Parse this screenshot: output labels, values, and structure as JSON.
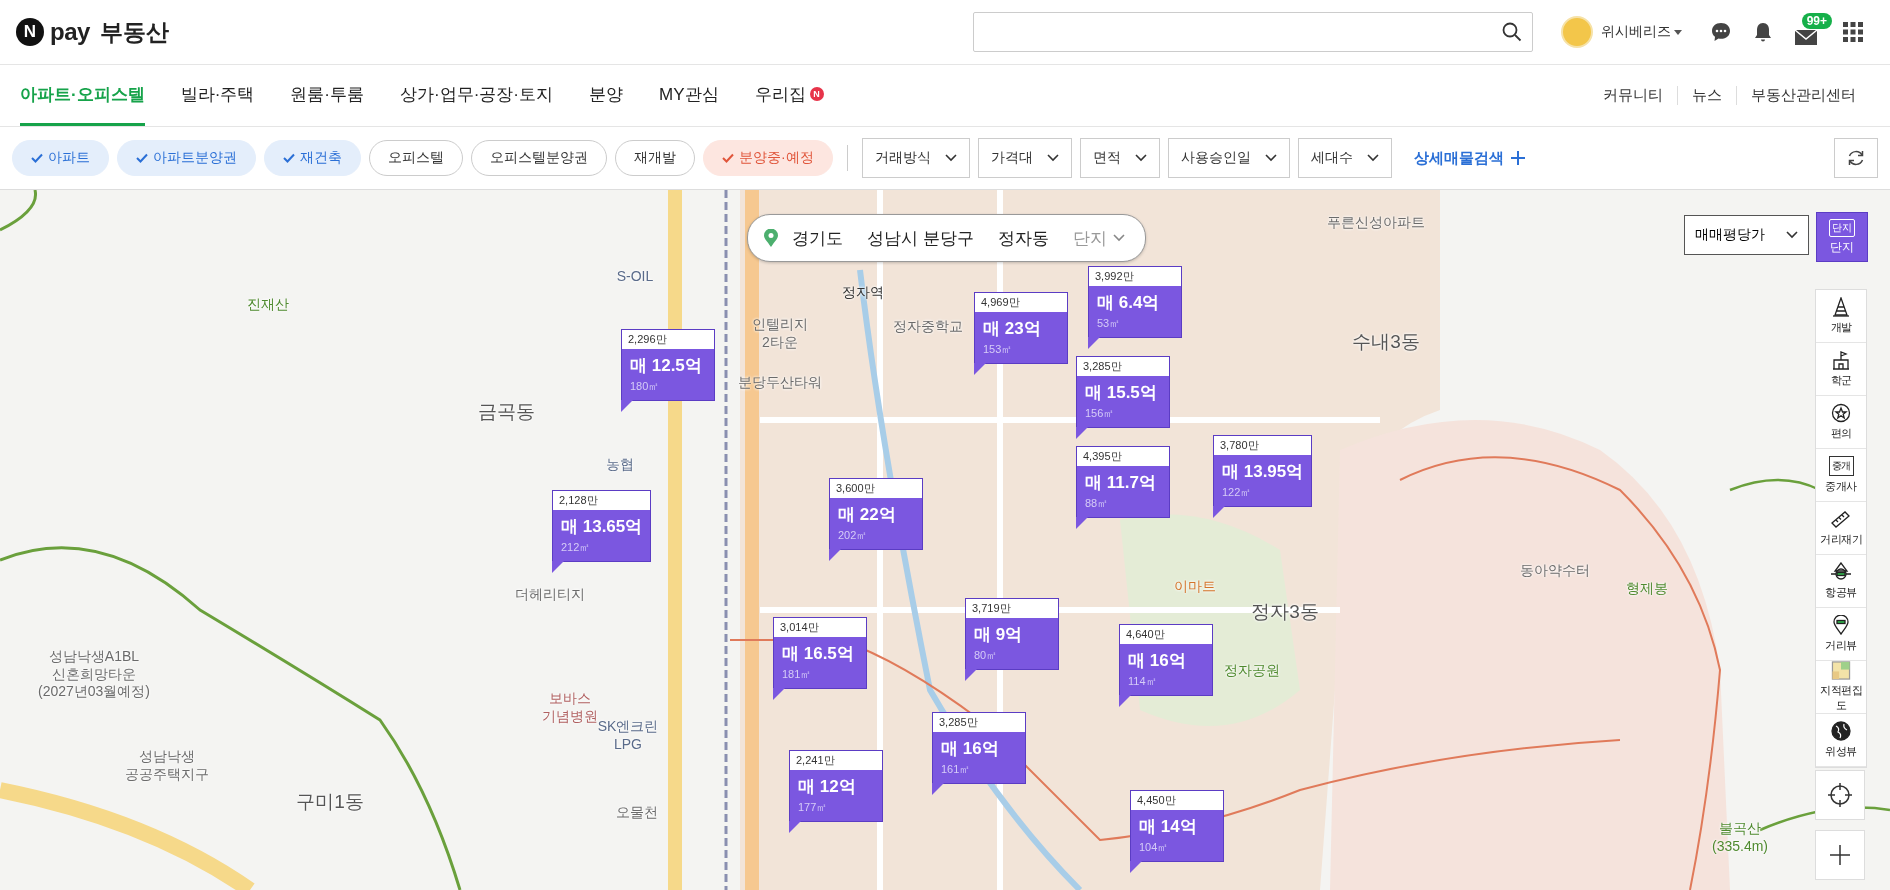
{
  "header": {
    "logo": {
      "mark": "N",
      "brand": "pay",
      "title": "부동산"
    },
    "user": {
      "name": "위시베리즈"
    },
    "mail_badge": "99+"
  },
  "nav": {
    "tabs": [
      {
        "label": "아파트·오피스텔",
        "selected": true
      },
      {
        "label": "빌라·주택",
        "selected": false
      },
      {
        "label": "원룸·투룸",
        "selected": false
      },
      {
        "label": "상가·업무·공장·토지",
        "selected": false
      },
      {
        "label": "분양",
        "selected": false
      },
      {
        "label": "MY관심",
        "selected": false
      },
      {
        "label": "우리집",
        "selected": false,
        "badge": "N"
      }
    ],
    "links": [
      "커뮤니티",
      "뉴스",
      "부동산관리센터"
    ]
  },
  "filters": {
    "chips": [
      {
        "label": "아파트",
        "checked": true,
        "kind": "type"
      },
      {
        "label": "아파트분양권",
        "checked": true,
        "kind": "type"
      },
      {
        "label": "재건축",
        "checked": true,
        "kind": "type"
      },
      {
        "label": "오피스텔",
        "checked": false,
        "kind": "type"
      },
      {
        "label": "오피스텔분양권",
        "checked": false,
        "kind": "type"
      },
      {
        "label": "재개발",
        "checked": false,
        "kind": "type"
      },
      {
        "label": "분양중·예정",
        "checked": true,
        "kind": "sale"
      }
    ],
    "dropdowns": [
      "거래방식",
      "가격대",
      "면적",
      "사용승인일",
      "세대수"
    ],
    "detail_search": "상세매물검색"
  },
  "map": {
    "breadcrumb": [
      {
        "label": "경기도",
        "kind": "region"
      },
      {
        "label": "성남시 분당구",
        "kind": "region"
      },
      {
        "label": "정자동",
        "kind": "region"
      },
      {
        "label": "단지",
        "kind": "placeholder"
      }
    ],
    "price_select": "매매평당가",
    "complex_toggle": {
      "icon_text": "단지",
      "label": "단지",
      "on": true
    },
    "tools": [
      {
        "label": "개발"
      },
      {
        "label": "학군"
      },
      {
        "label": "편의"
      },
      {
        "label": "중개사",
        "icon_text": "중개"
      },
      {
        "label": "거리재기"
      },
      {
        "label": "항공뷰"
      },
      {
        "label": "거리뷰"
      },
      {
        "label": "지적편집도"
      },
      {
        "label": "위성뷰"
      }
    ],
    "labels": [
      {
        "text": "진재산",
        "kind": "mountain"
      },
      {
        "text": "S-OIL",
        "kind": "poi"
      },
      {
        "text": "금곡동",
        "kind": "district"
      },
      {
        "text": "농협",
        "kind": "poi"
      },
      {
        "text": "더헤리티지",
        "kind": "place"
      },
      {
        "text": "성남낙생A1BL\n신혼희망타운\n(2027년03월예정)",
        "kind": "place"
      },
      {
        "text": "보바스\n기념병원",
        "kind": "hospital"
      },
      {
        "text": "SK엔크린\nLPG",
        "kind": "poi"
      },
      {
        "text": "성남낙생\n공공주택지구",
        "kind": "place"
      },
      {
        "text": "구미1동",
        "kind": "district"
      },
      {
        "text": "오물천",
        "kind": "place"
      },
      {
        "text": "정자역",
        "kind": "station"
      },
      {
        "text": "인텔리지\n2타운",
        "kind": "place"
      },
      {
        "text": "분당두산타워",
        "kind": "place"
      },
      {
        "text": "정자중학교",
        "kind": "place"
      },
      {
        "text": "푸른신성아파트",
        "kind": "place"
      },
      {
        "text": "수내3동",
        "kind": "district"
      },
      {
        "text": "이마트",
        "kind": "shop"
      },
      {
        "text": "정자3동",
        "kind": "district"
      },
      {
        "text": "정자공원",
        "kind": "mountain"
      },
      {
        "text": "동아약수터",
        "kind": "place"
      },
      {
        "text": "형제봉",
        "kind": "mountain"
      },
      {
        "text": "불곡산\n(335.4m)",
        "kind": "mountain"
      }
    ],
    "markers": [
      {
        "unit_price": "2,296만",
        "price": "매 12.5억",
        "area": "180㎡"
      },
      {
        "unit_price": "2,128만",
        "price": "매 13.65억",
        "area": "212㎡"
      },
      {
        "unit_price": "4,969만",
        "price": "매 23억",
        "area": "153㎡"
      },
      {
        "unit_price": "3,992만",
        "price": "매 6.4억",
        "area": "53㎡"
      },
      {
        "unit_price": "3,285만",
        "price": "매 15.5억",
        "area": "156㎡"
      },
      {
        "unit_price": "4,395만",
        "price": "매 11.7억",
        "area": "88㎡"
      },
      {
        "unit_price": "3,780만",
        "price": "매 13.95억",
        "area": "122㎡"
      },
      {
        "unit_price": "3,600만",
        "price": "매 22억",
        "area": "202㎡"
      },
      {
        "unit_price": "3,719만",
        "price": "매 9억",
        "area": "80㎡"
      },
      {
        "unit_price": "4,640만",
        "price": "매 16억",
        "area": "114㎡"
      },
      {
        "unit_price": "3,014만",
        "price": "매 16.5억",
        "area": "181㎡"
      },
      {
        "unit_price": "3,285만",
        "price": "매 16억",
        "area": "161㎡"
      },
      {
        "unit_price": "2,241만",
        "price": "매 12억",
        "area": "177㎡"
      },
      {
        "unit_price": "4,450만",
        "price": "매 14억",
        "area": "104㎡"
      }
    ]
  }
}
